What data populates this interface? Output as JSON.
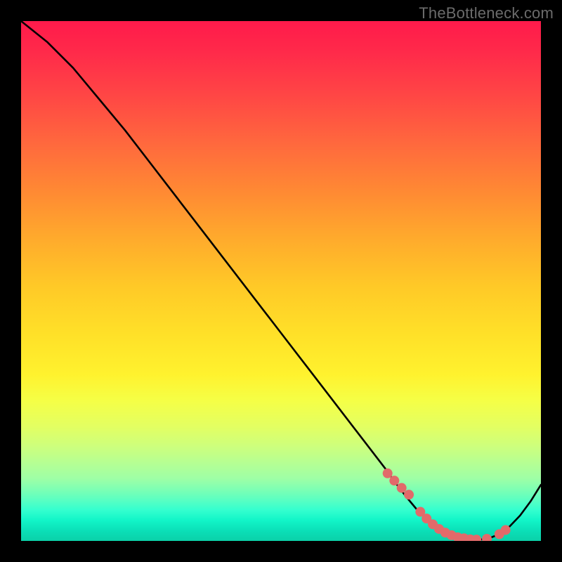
{
  "watermark": "TheBottleneck.com",
  "colors": {
    "background": "#000000",
    "curve": "#000000",
    "marker": "#e26a6a"
  },
  "chart_data": {
    "type": "line",
    "title": "",
    "xlabel": "",
    "ylabel": "",
    "xlim": [
      0,
      100
    ],
    "ylim": [
      0,
      100
    ],
    "grid": false,
    "legend": false,
    "series": [
      {
        "name": "bottleneck-curve",
        "x": [
          0,
          5,
          10,
          15,
          20,
          25,
          30,
          35,
          40,
          45,
          50,
          55,
          60,
          65,
          70,
          72,
          74,
          76,
          78,
          80,
          82,
          84,
          86,
          88,
          90,
          92,
          94,
          96,
          98,
          100
        ],
        "y": [
          100,
          96,
          91,
          85,
          79,
          72.5,
          66,
          59.5,
          53,
          46.5,
          40,
          33.5,
          27,
          20.5,
          14,
          11.2,
          8.6,
          6.2,
          4.2,
          2.6,
          1.4,
          0.7,
          0.3,
          0.2,
          0.5,
          1.3,
          2.8,
          4.9,
          7.6,
          10.8
        ]
      }
    ],
    "markers": {
      "name": "highlight-dots",
      "x": [
        70.5,
        71.8,
        73.2,
        74.6,
        76.8,
        78.0,
        79.2,
        80.4,
        81.6,
        82.8,
        84.0,
        85.2,
        86.4,
        87.6,
        89.6,
        92.0,
        93.2
      ],
      "y": [
        13.0,
        11.6,
        10.2,
        8.9,
        5.6,
        4.3,
        3.2,
        2.3,
        1.6,
        1.1,
        0.7,
        0.5,
        0.3,
        0.25,
        0.4,
        1.3,
        2.1
      ]
    },
    "background_gradient": {
      "direction": "top-to-bottom",
      "stops": [
        {
          "pos": 0.0,
          "color": "#ff1a4b"
        },
        {
          "pos": 0.33,
          "color": "#ff8a33"
        },
        {
          "pos": 0.6,
          "color": "#ffe028"
        },
        {
          "pos": 0.78,
          "color": "#ccff7e"
        },
        {
          "pos": 1.0,
          "color": "#0bd0a8"
        }
      ]
    }
  }
}
